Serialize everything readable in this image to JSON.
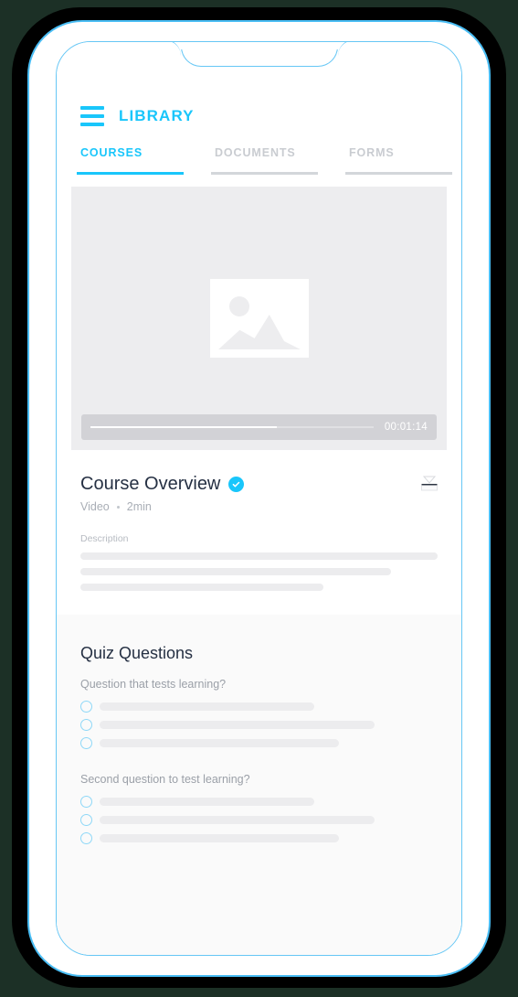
{
  "theme": {
    "accent": "#19c6fb",
    "radio_outline": "#8fd8f7",
    "muted_text": "#a9aeb6",
    "heading_text": "#253043",
    "skeleton": "#ececee",
    "quiz_bg": "#fafafa",
    "video_bg": "#ededef",
    "frame_outline": "#49bdf4"
  },
  "appbar": {
    "menu_icon": "hamburger-menu-icon",
    "brand": "LIBRARY"
  },
  "tabs": [
    {
      "label": "COURSES",
      "active": true
    },
    {
      "label": "DOCUMENTS",
      "active": false
    },
    {
      "label": "FORMS",
      "active": false
    }
  ],
  "video": {
    "placeholder_icon": "image-placeholder-icon",
    "timecode": "00:01:14",
    "progress_percent": 66
  },
  "course": {
    "title": "Course Overview",
    "verified_icon": "check-badge-icon",
    "type": "Video",
    "duration": "2min",
    "description_label": "Description",
    "description_lines": [
      100,
      87,
      68
    ],
    "download_icon": "download-icon"
  },
  "quiz": {
    "title": "Quiz Questions",
    "questions": [
      {
        "text": "Question that tests learning?",
        "options": [
          {
            "icon": "radio-unchecked-icon",
            "width": 60
          },
          {
            "icon": "radio-unchecked-icon",
            "width": 77
          },
          {
            "icon": "radio-unchecked-icon",
            "width": 67
          }
        ]
      },
      {
        "text": "Second question to test learning?",
        "options": [
          {
            "icon": "radio-unchecked-icon",
            "width": 60
          },
          {
            "icon": "radio-unchecked-icon",
            "width": 77
          },
          {
            "icon": "radio-unchecked-icon",
            "width": 67
          }
        ]
      }
    ]
  }
}
